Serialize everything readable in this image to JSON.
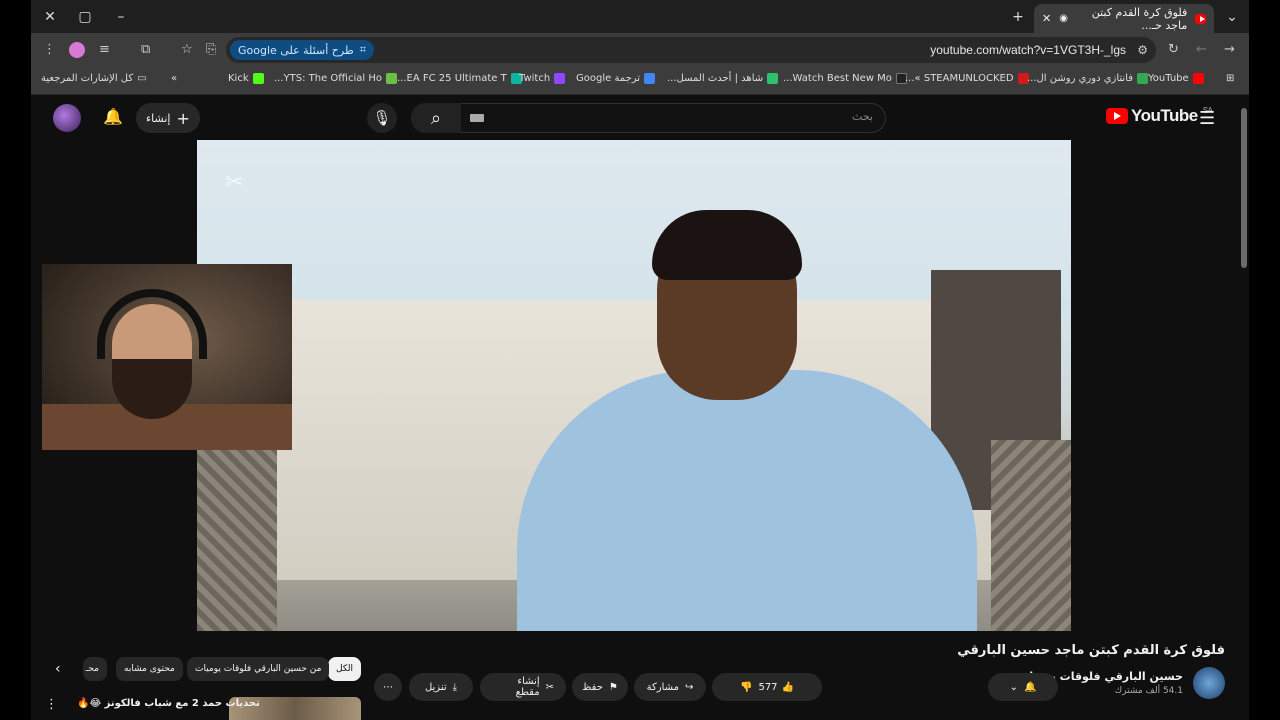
{
  "browser": {
    "tab_title": "فلوق كرة القدم كبتن ماجد حـ...",
    "url": "youtube.com/watch?v=1VGT3H-_lgs",
    "ask_google": "طرح أسئلة على Google"
  },
  "bookmarks": {
    "all_label": "كل الإشارات المرجعية",
    "items": [
      {
        "label": "Kick",
        "color": "#53fc18"
      },
      {
        "label": "YTS: The Official Ho...",
        "color": "#6ac045"
      },
      {
        "label": "EA FC 25 Ultimate T...",
        "color": "#0fb4a5"
      },
      {
        "label": "Twitch",
        "color": "#9146ff"
      },
      {
        "label": "ترجمة Google",
        "color": "#4285f4"
      },
      {
        "label": "شاهد | أحدث المسل...",
        "color": "#2ec26a"
      },
      {
        "label": "Watch Best New Mo...",
        "color": "#222222"
      },
      {
        "label": "STEAMUNLOCKED »...",
        "color": "#d11a1a"
      },
      {
        "label": "فانتازي دوري روشن ال...",
        "color": "#34a853"
      },
      {
        "label": "YouTube",
        "color": "#ff0000"
      }
    ]
  },
  "youtube": {
    "search_placeholder": "بحث",
    "create_label": "إنشاء",
    "logo_text": "YouTube",
    "region": "SA"
  },
  "video": {
    "title": "فلوق كرة القدم كبتن ماجد حسين البارقي",
    "channel": "حسين البارقي فلوقات يوميات",
    "subscribers": "54.1 ألف مشترك",
    "likes": "577",
    "share_label": "مشاركة",
    "save_label": "حفظ",
    "clip_label": "إنشاء مقطع",
    "download_label": "تنزيل"
  },
  "chips": {
    "all": "الكل",
    "from_channel": "من حسين البارقي فلوقات يوميات",
    "related": "محتوى مشابه",
    "more": "محـ"
  },
  "suggestion": {
    "title": "تحديات حمد 2 مع شباب فالكونز 😂🔥"
  },
  "colors": {
    "accent": "#ff0000",
    "background": "#0f0f0f",
    "chip_bg": "#272727"
  }
}
